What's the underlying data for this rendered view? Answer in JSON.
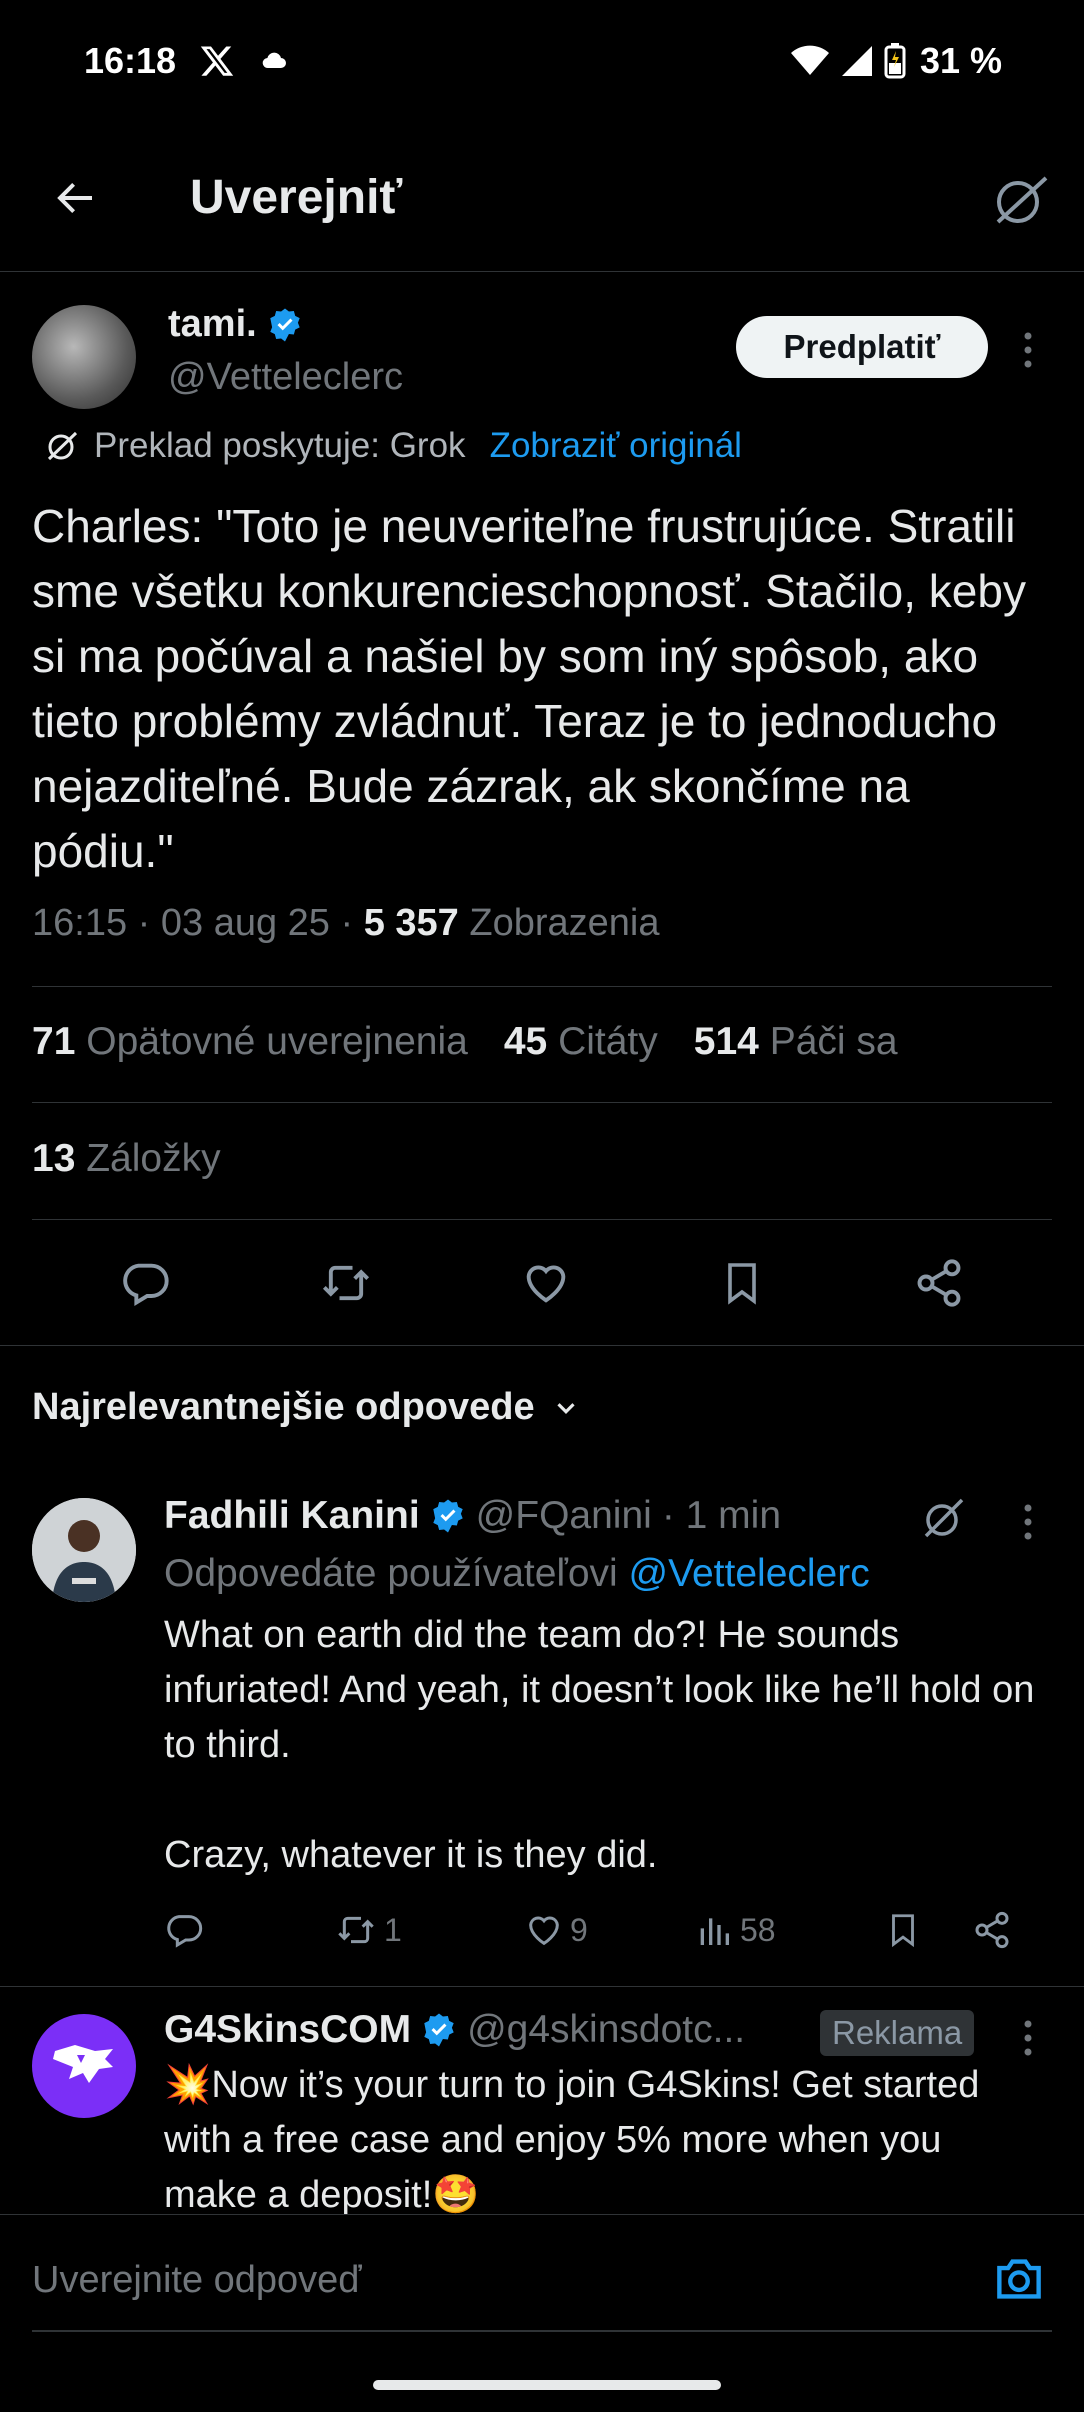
{
  "status_bar": {
    "time": "16:18",
    "battery": "31 %"
  },
  "header": {
    "title": "Uverejniť"
  },
  "post": {
    "author_name": "tami.",
    "author_handle": "@Vetteleclerc",
    "subscribe_label": "Predplatiť",
    "translation_note": "Preklad poskytuje: Grok",
    "show_original": "Zobraziť originál",
    "text": "Charles: \"Toto je neuveriteľne frustrujúce. Stratili sme všetku konkurencieschopnosť. Stačilo, keby si ma počúval a našiel by som iný spôsob, ako tieto problémy zvládnuť. Teraz je to jednoducho nejazditeľné. Bude zázrak, ak skončíme na pódiu.\"",
    "time": "16:15",
    "date": "03 aug 25",
    "views_count": "5 357",
    "views_label": "Zobrazenia",
    "reposts_count": "71",
    "reposts_label": "Opätovné uverejnenia",
    "quotes_count": "45",
    "quotes_label": "Citáty",
    "likes_count": "514",
    "likes_label": "Páči sa",
    "bookmarks_count": "13",
    "bookmarks_label": "Záložky"
  },
  "sort_label": "Najrelevantnejšie odpovede",
  "reply": {
    "author_name": "Fadhili Kanini",
    "author_handle": "@FQanini",
    "age": "· 1 min",
    "replying_to_label": "Odpovedáte používateľovi",
    "replying_to_handle": "@Vetteleclerc",
    "text": "What on earth did the team do?! He sounds infuriated! And yeah, it doesn’t look like he’ll hold on to third.\n\nCrazy, whatever it is they did.",
    "reposts": "1",
    "likes": "9",
    "views": "58"
  },
  "ad": {
    "author_name": "G4SkinsCOM",
    "author_handle": "@g4skinsdotc...",
    "badge": "Reklama",
    "text": "💥Now it’s your turn to join G4Skins! Get started with a free case and enjoy 5% more when you make a deposit!🤩"
  },
  "composer": {
    "placeholder": "Uverejnite odpoveď"
  },
  "colors": {
    "accent": "#1d9bf0",
    "muted": "#71767b",
    "background": "#000000",
    "divider": "#2f3336"
  }
}
